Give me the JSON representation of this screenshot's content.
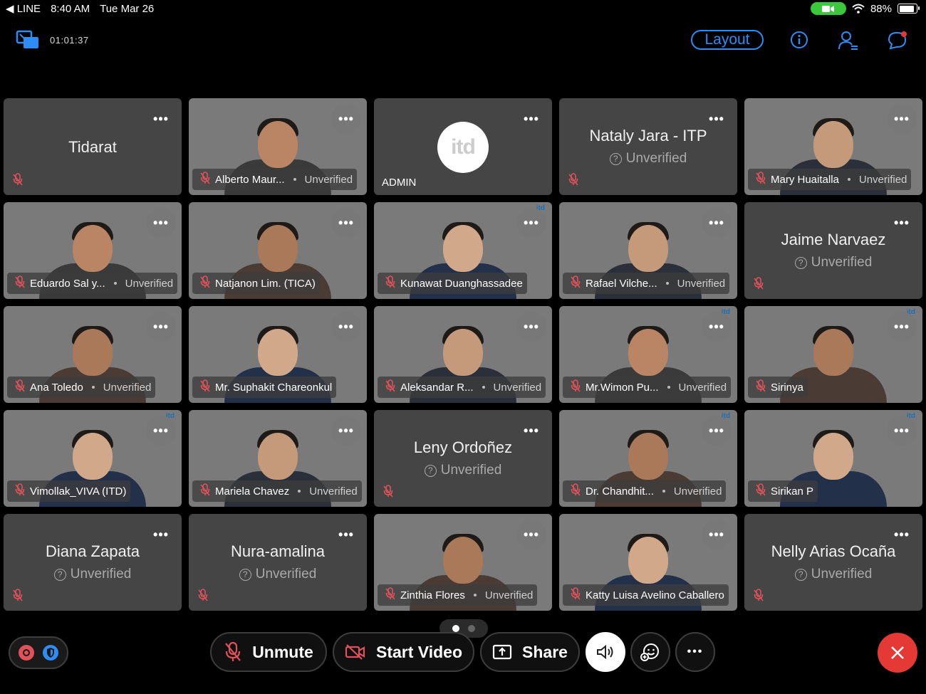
{
  "status_bar": {
    "carrier": "◀ LINE",
    "time": "8:40 AM",
    "date": "Tue Mar 26",
    "battery": "88%",
    "battery_level": 0.88
  },
  "toolbar": {
    "timer": "01:01:37",
    "layout_label": "Layout"
  },
  "participants": [
    {
      "name": "Tidarat",
      "kind": "audio",
      "status": ""
    },
    {
      "name": "Alberto Maur...",
      "kind": "video",
      "status": "Unverified",
      "bg": "bg-blue"
    },
    {
      "name": "ADMIN",
      "kind": "admin",
      "status": ""
    },
    {
      "name": "Nataly Jara - ITP",
      "kind": "audio",
      "status": "Unverified"
    },
    {
      "name": "Mary Huaitalla",
      "kind": "video",
      "status": "Unverified",
      "bg": "bg-office"
    },
    {
      "name": "Eduardo Sal y...",
      "kind": "video",
      "status": "Unverified",
      "bg": "bg-green"
    },
    {
      "name": "Natjanon Lim. (TICA)",
      "kind": "video",
      "status": "",
      "bg": "bg-wall"
    },
    {
      "name": "Kunawat Duanghassadee",
      "kind": "video",
      "status": "",
      "bg": "bg-teal"
    },
    {
      "name": "Rafael Vilche...",
      "kind": "video",
      "status": "Unverified",
      "bg": "bg-white"
    },
    {
      "name": "Jaime Narvaez",
      "kind": "audio",
      "status": "Unverified"
    },
    {
      "name": "Ana Toledo",
      "kind": "video",
      "status": "Unverified",
      "bg": "bg-room"
    },
    {
      "name": "Mr. Suphakit Chareonkul",
      "kind": "video",
      "status": "",
      "bg": "bg-itd"
    },
    {
      "name": "Aleksandar R...",
      "kind": "video",
      "status": "Unverified",
      "bg": "bg-white"
    },
    {
      "name": "Mr.Wimon Pu...",
      "kind": "video",
      "status": "Unverified",
      "bg": "bg-teal"
    },
    {
      "name": "Sirinya",
      "kind": "video",
      "status": "",
      "bg": "bg-teal"
    },
    {
      "name": "Vimollak_VIVA (ITD)",
      "kind": "video",
      "status": "",
      "bg": "bg-teal"
    },
    {
      "name": "Mariela Chavez",
      "kind": "video",
      "status": "Unverified",
      "bg": "bg-pink"
    },
    {
      "name": "Leny Ordoñez",
      "kind": "audio",
      "status": "Unverified"
    },
    {
      "name": "Dr. Chandhit...",
      "kind": "video",
      "status": "Unverified",
      "bg": "bg-teal"
    },
    {
      "name": "Sirikan P",
      "kind": "video",
      "status": "",
      "bg": "bg-teal"
    },
    {
      "name": "Diana Zapata",
      "kind": "audio",
      "status": "Unverified"
    },
    {
      "name": "Nura-amalina",
      "kind": "audio",
      "status": "Unverified"
    },
    {
      "name": "Zinthia Flores",
      "kind": "video",
      "status": "Unverified",
      "bg": "bg-kitchen"
    },
    {
      "name": "Katty Luisa Avelino Caballero",
      "kind": "video",
      "status": "",
      "bg": "bg-white"
    },
    {
      "name": "Nelly Arias Ocaña",
      "kind": "audio",
      "status": "Unverified"
    }
  ],
  "more_glyph": "•••",
  "controls": {
    "unmute": "Unmute",
    "start_video": "Start Video",
    "share": "Share"
  },
  "colors": {
    "accent": "#2f8cf5",
    "end": "#e53935",
    "mute": "#e0525a",
    "camera_pill": "#3cc83c"
  }
}
